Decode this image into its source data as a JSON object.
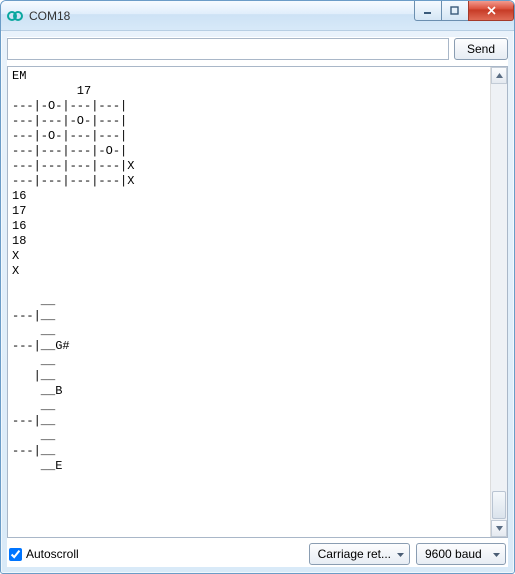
{
  "window": {
    "title": "COM18"
  },
  "toolbar": {
    "input_value": "",
    "input_placeholder": "",
    "send_label": "Send"
  },
  "console": {
    "text": "EM\n         17\n---|-O-|---|---|\n---|---|-O-|---|\n---|-O-|---|---|\n---|---|---|-O-|\n---|---|---|---|X\n---|---|---|---|X\n16\n17\n16\n18\nX\nX\n\n    __\n---|__\n    __\n---|__G#\n    __\n   |__\n    __B\n    __\n---|__\n    __\n---|__\n    __E"
  },
  "footer": {
    "autoscroll_label": "Autoscroll",
    "autoscroll_checked": true,
    "lineending_selected": "Carriage ret...",
    "baud_selected": "9600 baud"
  }
}
